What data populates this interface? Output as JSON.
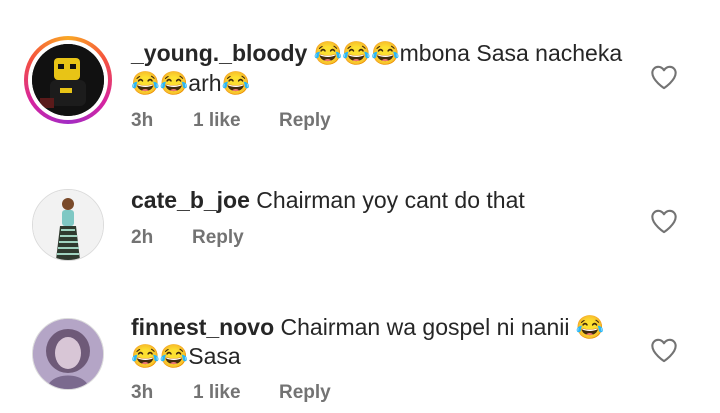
{
  "comments": [
    {
      "username": "_young._bloody",
      "line1_text": "😂😂😂mbona Sasa nacheka",
      "line2_text": "😂😂arh😂",
      "time": "3h",
      "likes": "1 like",
      "reply_label": "Reply",
      "has_story_ring": true
    },
    {
      "username": "cate_b_joe",
      "line1_text": "Chairman yoy cant do that",
      "line2_text": "",
      "time": "2h",
      "likes": "",
      "reply_label": "Reply",
      "has_story_ring": false
    },
    {
      "username": "finnest_novo",
      "line1_text": "Chairman wa gospel ni nanii 😂",
      "line2_text": "😂😂Sasa",
      "time": "3h",
      "likes": "1 like",
      "reply_label": "Reply",
      "has_story_ring": false
    }
  ],
  "icons": {
    "like": "heart-outline-icon"
  },
  "colors": {
    "text": "#262626",
    "meta": "#737373",
    "ring_start": "#f9a825",
    "ring_end": "#d6249f"
  }
}
